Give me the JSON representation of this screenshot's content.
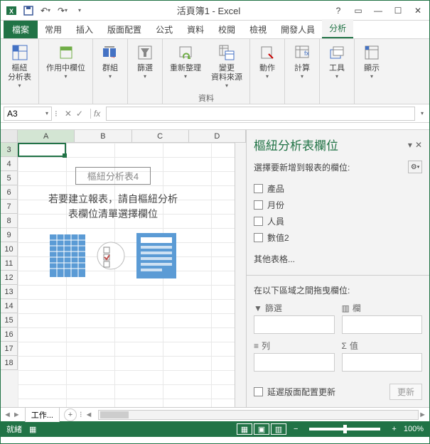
{
  "title": "活頁簿1 - Excel",
  "ribbon_tabs": {
    "file": "檔案",
    "home": "常用",
    "insert": "插入",
    "layout": "版面配置",
    "formulas": "公式",
    "data": "資料",
    "review": "校閱",
    "view": "檢視",
    "developer": "開發人員",
    "analyze": "分析"
  },
  "ribbon": {
    "pivot_table": "樞紐\n分析表",
    "active_field": "作用中欄位",
    "group": "群組",
    "filter": "篩選",
    "refresh": "重新整理",
    "change_source": "變更\n資料來源",
    "actions": "動作",
    "calc": "計算",
    "tools": "工具",
    "show": "顯示",
    "group_data_label": "資料"
  },
  "namebox": "A3",
  "fx": "fx",
  "columns": [
    "A",
    "B",
    "C",
    "D"
  ],
  "rows_start": 3,
  "rows_end": 18,
  "pivot_placeholder": {
    "title": "樞紐分析表4",
    "line1": "若要建立報表，請自樞紐分析",
    "line2": "表欄位清單選擇欄位"
  },
  "panel": {
    "title": "樞紐分析表欄位",
    "subtitle": "選擇要新增到報表的欄位:",
    "fields": [
      "產品",
      "月份",
      "人員",
      "數值2"
    ],
    "more_tables": "其他表格...",
    "drag_label": "在以下區域之間拖曳欄位:",
    "zones": {
      "filter": "篩選",
      "columns": "欄",
      "rows": "列",
      "values": "值"
    },
    "defer": "延遲版面配置更新",
    "update": "更新"
  },
  "sheet_tab": "工作...",
  "status": {
    "ready": "就緒",
    "zoom": "100%"
  }
}
